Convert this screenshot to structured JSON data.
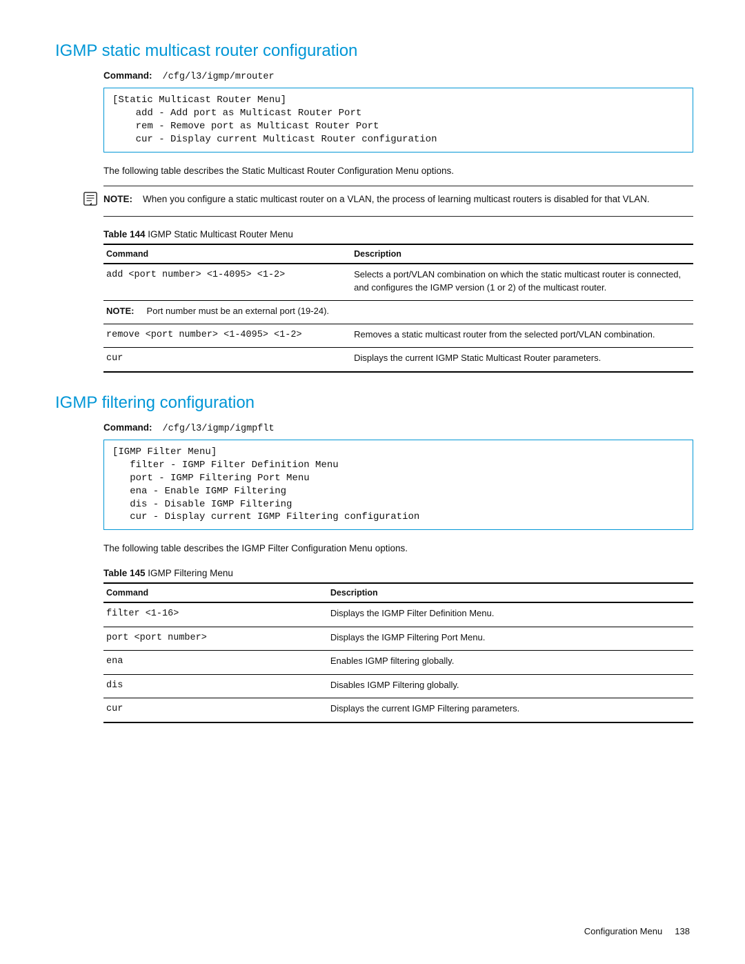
{
  "section1": {
    "heading": "IGMP static multicast router configuration",
    "command_label": "Command:",
    "command_path": "/cfg/l3/igmp/mrouter",
    "codebox": "[Static Multicast Router Menu]\n    add - Add port as Multicast Router Port\n    rem - Remove port as Multicast Router Port\n    cur - Display current Multicast Router configuration",
    "intro": "The following table describes the Static Multicast Router Configuration Menu options.",
    "note_label": "NOTE:",
    "note_text": "When you configure a static multicast router on a VLAN, the process of learning multicast routers is disabled for that VLAN.",
    "table_caption_prefix": "Table 144",
    "table_caption_text": " IGMP Static Multicast Router Menu",
    "headers": {
      "c1": "Command",
      "c2": "Description"
    },
    "rows": [
      {
        "cmd": "add <port number> <1-4095> <1-2>",
        "desc": "Selects a port/VLAN combination on which the static multicast router is connected, and configures the IGMP version (1 or 2) of the multicast router."
      },
      {
        "note_label": "NOTE:",
        "note_text": "Port number must be an external port (19-24)."
      },
      {
        "cmd": "remove <port number> <1-4095> <1-2>",
        "desc": "Removes a static multicast router from the selected port/VLAN combination."
      },
      {
        "cmd": "cur",
        "desc": "Displays the current IGMP Static Multicast Router parameters."
      }
    ]
  },
  "section2": {
    "heading": "IGMP filtering configuration",
    "command_label": "Command:",
    "command_path": "/cfg/l3/igmp/igmpflt",
    "codebox": "[IGMP Filter Menu]\n   filter - IGMP Filter Definition Menu\n   port - IGMP Filtering Port Menu\n   ena - Enable IGMP Filtering\n   dis - Disable IGMP Filtering\n   cur - Display current IGMP Filtering configuration",
    "intro": "The following table describes the IGMP Filter Configuration Menu options.",
    "table_caption_prefix": "Table 145",
    "table_caption_text": " IGMP Filtering Menu",
    "headers": {
      "c1": "Command",
      "c2": "Description"
    },
    "rows": [
      {
        "cmd": "filter <1-16>",
        "desc": "Displays the IGMP Filter Definition Menu."
      },
      {
        "cmd": "port <port number>",
        "desc": "Displays the IGMP Filtering Port Menu."
      },
      {
        "cmd": "ena",
        "desc": "Enables IGMP filtering globally."
      },
      {
        "cmd": "dis",
        "desc": "Disables IGMP Filtering globally."
      },
      {
        "cmd": "cur",
        "desc": "Displays the current IGMP Filtering parameters."
      }
    ]
  },
  "footer": {
    "section": "Configuration Menu",
    "page": "138"
  }
}
